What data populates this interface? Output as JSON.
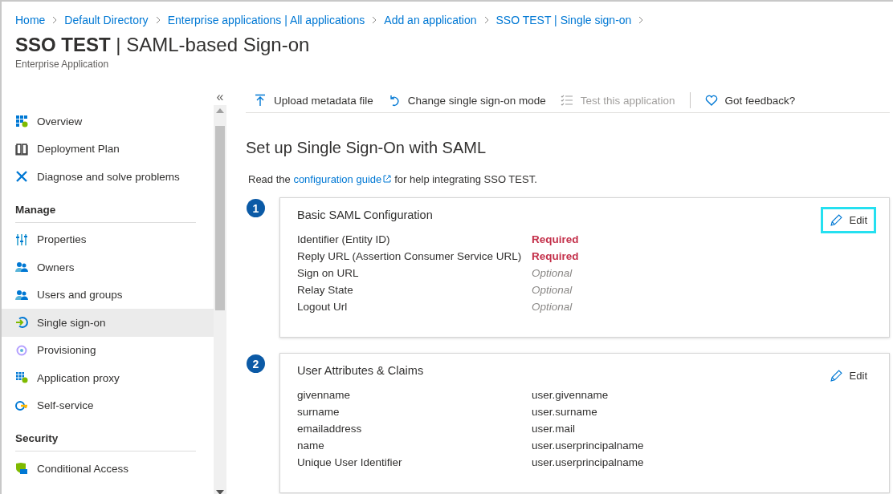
{
  "breadcrumb": [
    "Home",
    "Default Directory",
    "Enterprise applications | All applications",
    "Add an application",
    "SSO TEST | Single sign-on"
  ],
  "header": {
    "title_strong": "SSO TEST",
    "title_rest": "| SAML-based Sign-on",
    "subtitle": "Enterprise Application"
  },
  "sidebar": {
    "collapse": "«",
    "groups": [
      {
        "items": [
          {
            "label": "Overview",
            "selected": false
          },
          {
            "label": "Deployment Plan",
            "selected": false
          },
          {
            "label": "Diagnose and solve problems",
            "selected": false
          }
        ]
      },
      {
        "heading": "Manage",
        "items": [
          {
            "label": "Properties",
            "selected": false
          },
          {
            "label": "Owners",
            "selected": false
          },
          {
            "label": "Users and groups",
            "selected": false
          },
          {
            "label": "Single sign-on",
            "selected": true
          },
          {
            "label": "Provisioning",
            "selected": false
          },
          {
            "label": "Application proxy",
            "selected": false
          },
          {
            "label": "Self-service",
            "selected": false
          }
        ]
      },
      {
        "heading": "Security",
        "items": [
          {
            "label": "Conditional Access",
            "selected": false
          }
        ]
      }
    ]
  },
  "toolbar": [
    {
      "label": "Upload metadata file",
      "disabled": false
    },
    {
      "label": "Change single sign-on mode",
      "disabled": false
    },
    {
      "label": "Test this application",
      "disabled": true
    },
    {
      "label": "Got feedback?",
      "disabled": false
    }
  ],
  "page_title": "Set up Single Sign-On with SAML",
  "intro": {
    "before": "Read the",
    "link": "configuration guide",
    "after": "for help integrating SSO TEST."
  },
  "steps": [
    {
      "number": "1",
      "title": "Basic SAML Configuration",
      "edit": {
        "label": "Edit",
        "highlighted": true
      },
      "rows": [
        {
          "name": "Identifier (Entity ID)",
          "value": "Required",
          "kind": "required"
        },
        {
          "name": "Reply URL (Assertion Consumer Service URL)",
          "value": "Required",
          "kind": "required"
        },
        {
          "name": "Sign on URL",
          "value": "Optional",
          "kind": "optional"
        },
        {
          "name": "Relay State",
          "value": "Optional",
          "kind": "optional"
        },
        {
          "name": "Logout Url",
          "value": "Optional",
          "kind": "optional"
        }
      ]
    },
    {
      "number": "2",
      "title": "User Attributes & Claims",
      "edit": {
        "label": "Edit",
        "highlighted": false
      },
      "rows": [
        {
          "name": "givenname",
          "value": "user.givenname",
          "kind": "value"
        },
        {
          "name": "surname",
          "value": "user.surname",
          "kind": "value"
        },
        {
          "name": "emailaddress",
          "value": "user.mail",
          "kind": "value"
        },
        {
          "name": "name",
          "value": "user.userprincipalname",
          "kind": "value"
        },
        {
          "name": "Unique User Identifier",
          "value": "user.userprincipalname",
          "kind": "value"
        }
      ]
    }
  ]
}
